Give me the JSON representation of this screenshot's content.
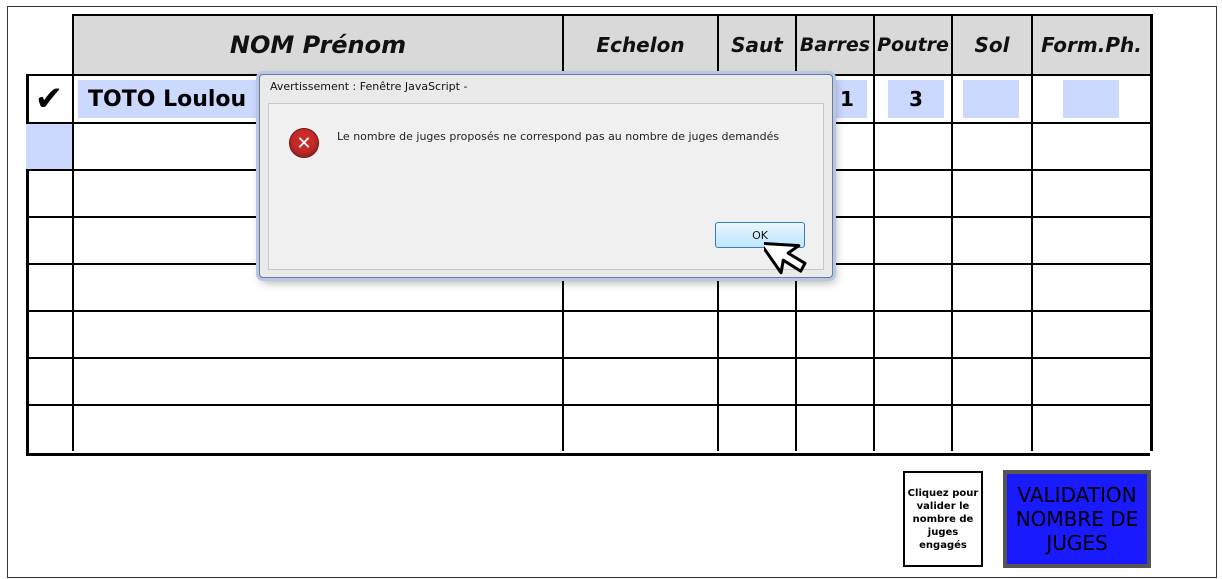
{
  "table": {
    "headers": {
      "name": "NOM Prénom",
      "echelon": "Echelon",
      "saut": "Saut",
      "barres": "Barres",
      "poutre": "Poutre",
      "sol": "Sol",
      "form_ph": "Form.Ph."
    },
    "row1": {
      "check": "✔",
      "name": "TOTO Loulou",
      "barres": "1",
      "poutre": "3"
    }
  },
  "dialog": {
    "title": "Avertissement : Fenêtre JavaScript -",
    "message": "Le nombre de juges proposés ne correspond pas au nombre de juges demandés",
    "icon": "error-icon",
    "ok_label": "OK"
  },
  "footer": {
    "info_text": "Cliquez pour valider le nombre de juges engagés",
    "validation_button": "VALIDATION NOMBRE DE JUGES"
  },
  "colors": {
    "header_bg": "#d9d9d9",
    "input_bg": "#ccd9ff",
    "validation_bg": "#1a1aff"
  }
}
